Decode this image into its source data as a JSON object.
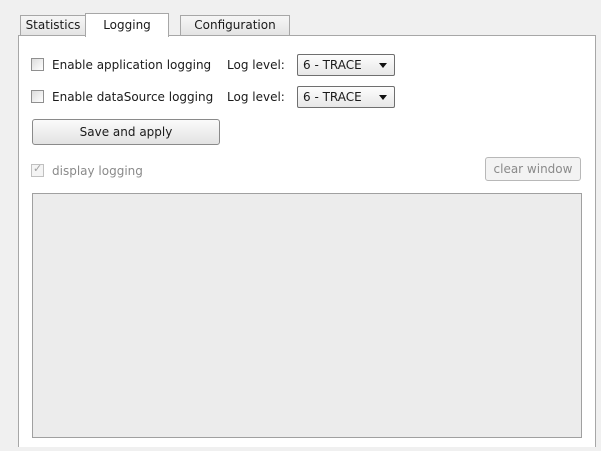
{
  "tabs": [
    {
      "label": "Statistics",
      "active": false
    },
    {
      "label": "Logging",
      "active": true
    },
    {
      "label": "Configuration",
      "active": false
    }
  ],
  "logging": {
    "app_logging": {
      "label": "Enable application logging",
      "checked": false,
      "level_label": "Log level:",
      "level_value": "6 - TRACE"
    },
    "ds_logging": {
      "label": "Enable dataSource logging",
      "checked": false,
      "level_label": "Log level:",
      "level_value": "6 - TRACE"
    },
    "save_button": "Save and apply",
    "display_logging": {
      "label": "display logging",
      "checked": true,
      "disabled": true
    },
    "clear_button": "clear window",
    "log_text": ""
  }
}
